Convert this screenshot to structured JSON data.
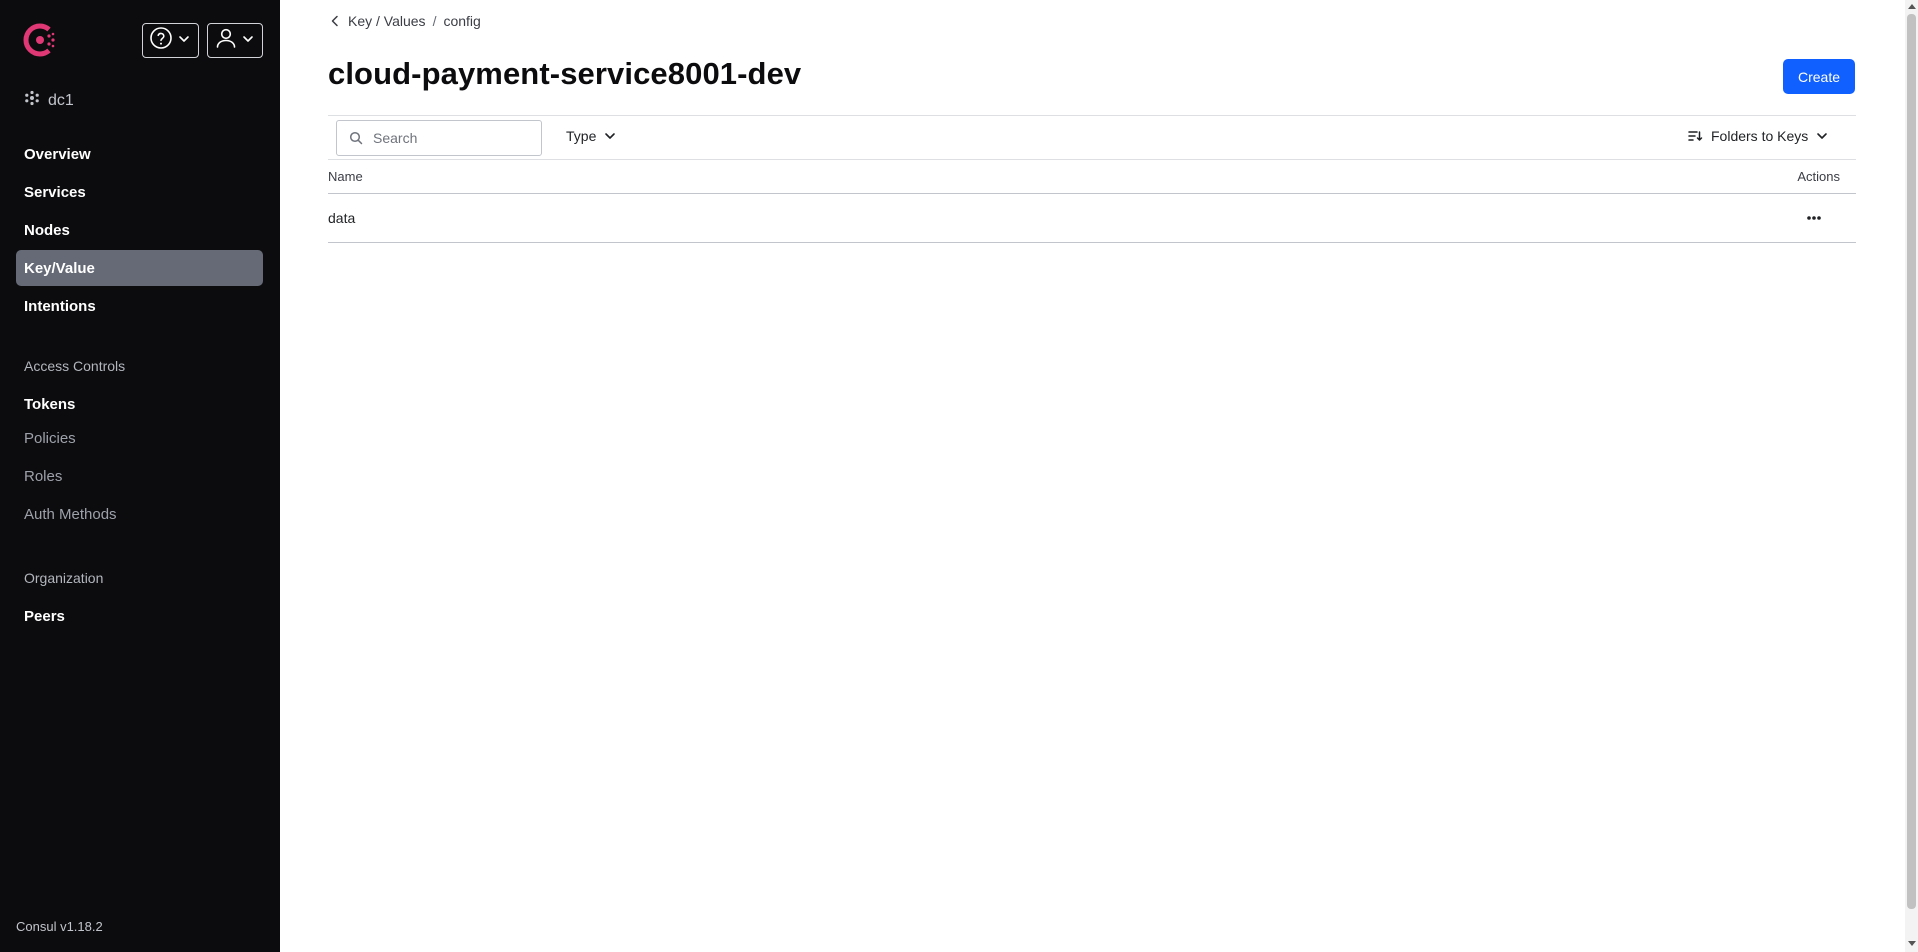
{
  "header": {
    "help_icon": "help-circle-icon",
    "user_icon": "user-icon"
  },
  "sidebar": {
    "datacenter": "dc1",
    "items": [
      {
        "label": "Overview"
      },
      {
        "label": "Services"
      },
      {
        "label": "Nodes"
      },
      {
        "label": "Key/Value",
        "active": true
      },
      {
        "label": "Intentions"
      }
    ],
    "access_controls": {
      "heading": "Access Controls",
      "items": [
        {
          "label": "Tokens"
        },
        {
          "label": "Policies"
        },
        {
          "label": "Roles"
        },
        {
          "label": "Auth Methods"
        }
      ]
    },
    "organization": {
      "heading": "Organization",
      "items": [
        {
          "label": "Peers"
        }
      ]
    },
    "version": "Consul v1.18.2"
  },
  "breadcrumb": {
    "items": [
      "Key / Values",
      "config"
    ],
    "separator": "/"
  },
  "page": {
    "title": "cloud-payment-service8001-dev",
    "create_label": "Create"
  },
  "toolbar": {
    "search_placeholder": "Search",
    "type_label": "Type",
    "sort_label": "Folders to Keys"
  },
  "table": {
    "columns": [
      "Name",
      "Actions"
    ],
    "rows": [
      {
        "name": "data"
      }
    ]
  },
  "colors": {
    "sidebar_bg": "#0c0c0e",
    "active_item_bg": "#656a76",
    "primary": "#1060ff",
    "brand": "#e03875"
  }
}
